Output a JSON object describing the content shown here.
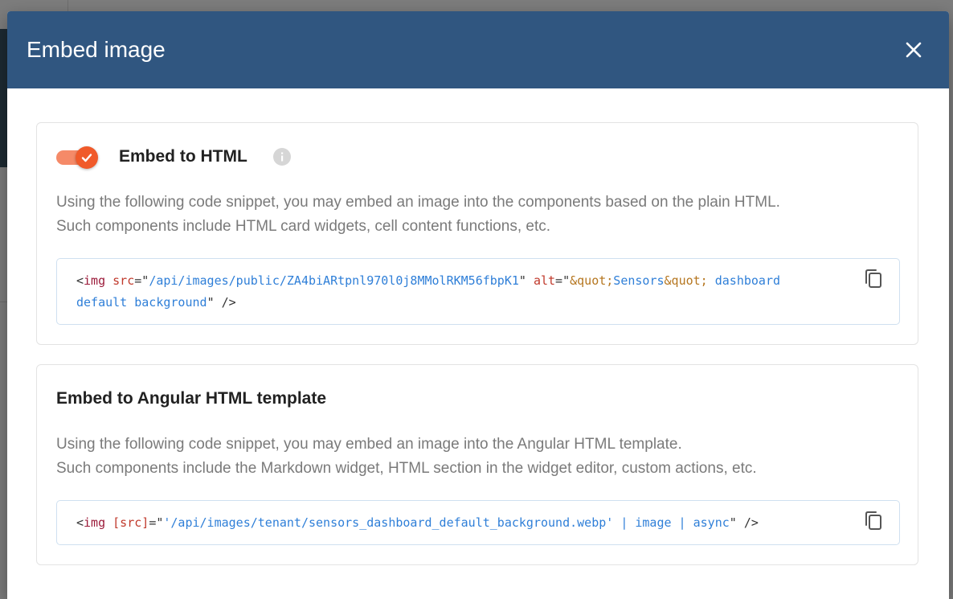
{
  "dialog": {
    "title": "Embed image",
    "close_icon": "close-icon",
    "header_color": "#305680"
  },
  "html_section": {
    "toggle_on": true,
    "toggle_color": "#f05a2a",
    "title": "Embed to HTML",
    "info_icon": "info-icon",
    "description_lines": [
      "Using the following code snippet, you may embed an image into the components based on the plain HTML.",
      "Such components include HTML card widgets, cell content functions, etc."
    ],
    "code": {
      "line1": {
        "open": "<",
        "tag": "img",
        "sp1": " ",
        "attr_src": "src",
        "eq1": "=\"",
        "src_value": "/api/images/public/ZA4biARtpnl970l0j8MMolRKM56fbpK1",
        "q1": "\"",
        "sp2": " ",
        "attr_alt": "alt",
        "eq2": "=\"",
        "ent1": "&quot;",
        "alt_word": "Sensors",
        "ent2": "&quot;",
        "alt_rest": " dashboard"
      },
      "line2": {
        "alt_cont": "default background",
        "close": "\" />"
      }
    },
    "copy_icon": "copy-icon"
  },
  "angular_section": {
    "title": "Embed to Angular HTML template",
    "description_lines": [
      "Using the following code snippet, you may embed an image into the Angular HTML template.",
      "Such components include the Markdown widget, HTML section in the widget editor, custom actions, etc."
    ],
    "code": {
      "open": "<",
      "tag": "img",
      "sp1": " ",
      "attr_src": "[src]",
      "eq": "=\"",
      "value": "'/api/images/tenant/sensors_dashboard_default_background.webp' | image | async",
      "close": "\" />"
    },
    "copy_icon": "copy-icon"
  }
}
